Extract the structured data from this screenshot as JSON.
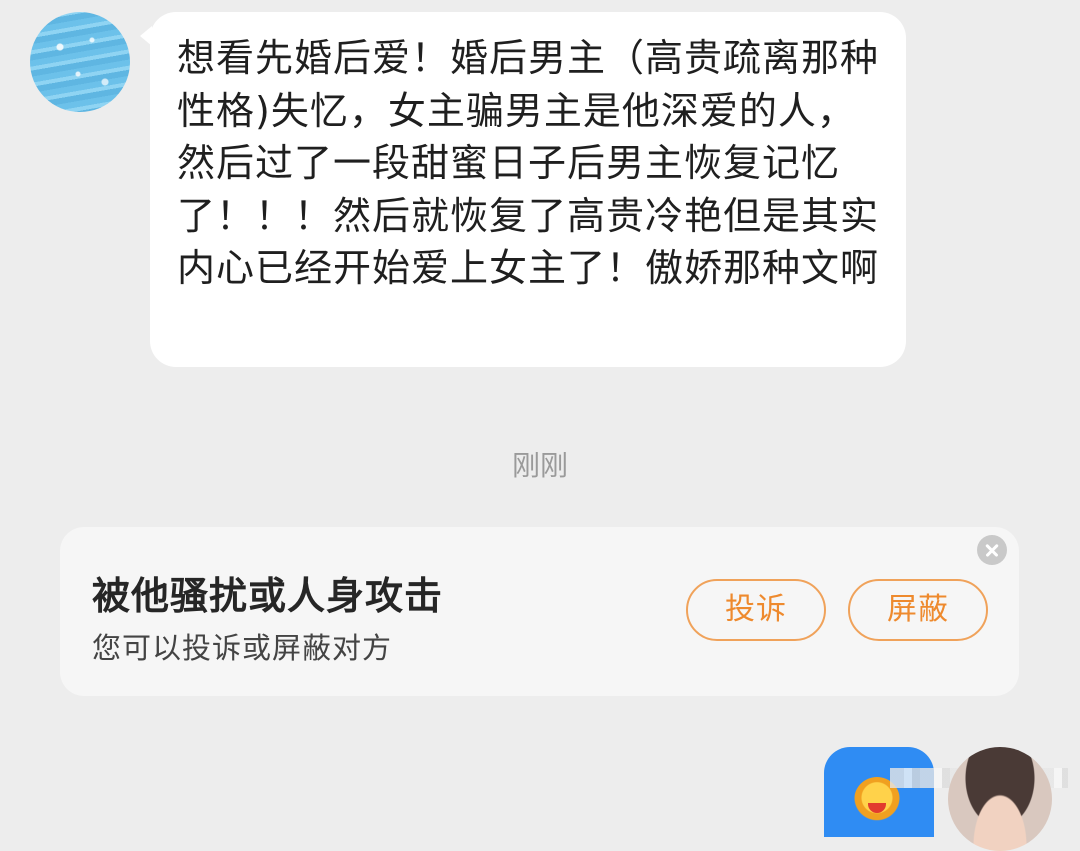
{
  "incoming_message": {
    "text": "想看先婚后爱！婚后男主（高贵疏离那种性格)失忆，女主骗男主是他深爱的人，然后过了一段甜蜜日子后男主恢复记忆了！！！然后就恢复了高贵冷艳但是其实内心已经开始爱上女主了！傲娇那种文啊"
  },
  "timestamp": "刚刚",
  "report_card": {
    "title": "被他骚扰或人身攻击",
    "subtitle": "您可以投诉或屏蔽对方",
    "report_label": "投诉",
    "block_label": "屏蔽"
  },
  "colors": {
    "background": "#ededed",
    "bubble": "#ffffff",
    "accent_orange": "#ee8a2e",
    "outgoing_blue": "#2f8cf3"
  },
  "icons": {
    "close": "close-icon",
    "sticker": "sticker-image"
  }
}
